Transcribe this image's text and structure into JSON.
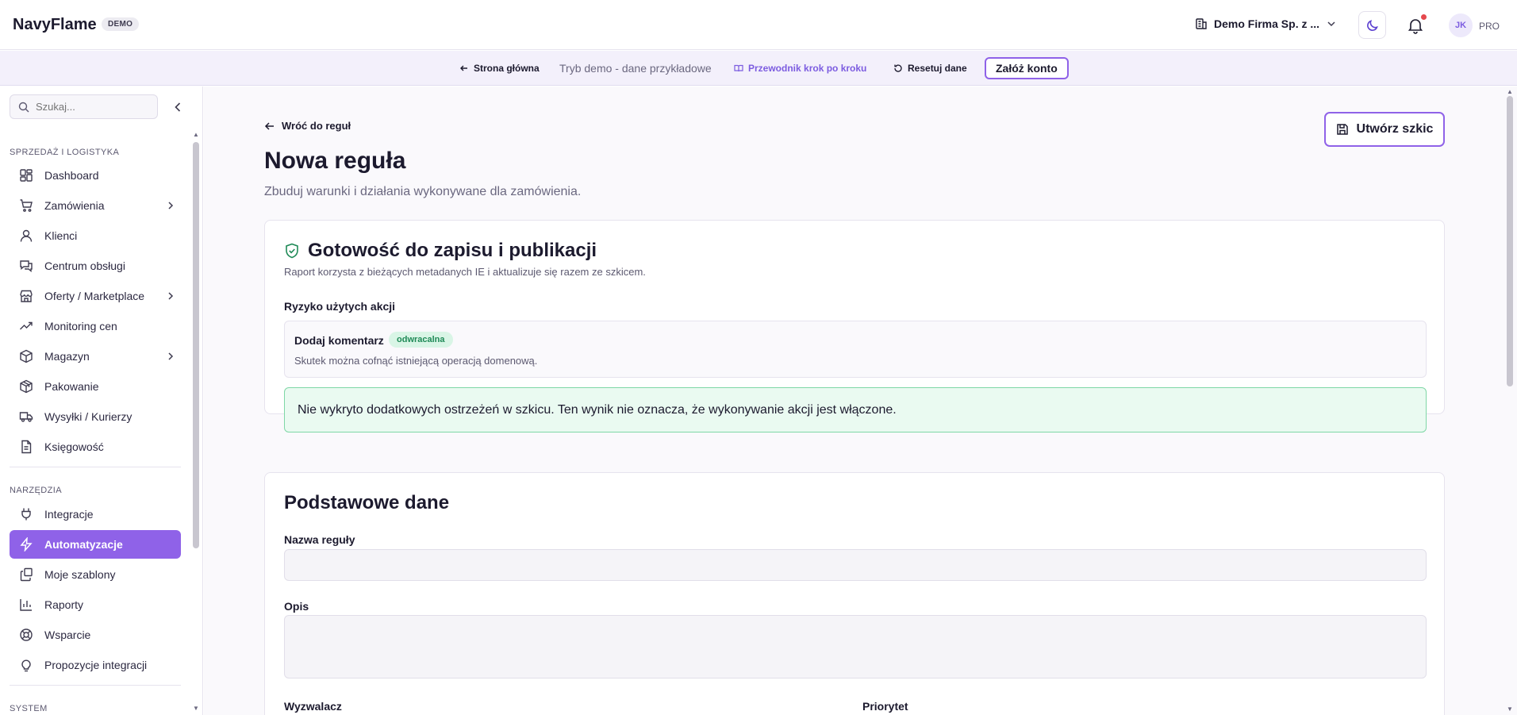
{
  "header": {
    "brand": "NavyFlame",
    "brand_badge": "DEMO",
    "company": "Demo Firma Sp. z ...",
    "avatar_initials": "JK",
    "plan": "PRO",
    "accent_color": "#8f62e8",
    "notification_color": "#e5484d"
  },
  "demo_bar": {
    "home": "Strona główna",
    "mode": "Tryb demo - dane przykładowe",
    "guide": "Przewodnik krok po kroku",
    "reset": "Resetuj dane",
    "create_account": "Załóż konto"
  },
  "sidebar": {
    "search_placeholder": "Szukaj...",
    "sections": [
      {
        "label": "SPRZEDAŻ I LOGISTYKA"
      },
      {
        "label": "NARZĘDZIA"
      },
      {
        "label": "SYSTEM"
      }
    ],
    "items": [
      {
        "label": "Dashboard",
        "icon": "dashboard-icon"
      },
      {
        "label": "Zamówienia",
        "icon": "cart-icon",
        "has_children": true
      },
      {
        "label": "Klienci",
        "icon": "user-icon"
      },
      {
        "label": "Centrum obsługi",
        "icon": "chat-icon"
      },
      {
        "label": "Oferty / Marketplace",
        "icon": "store-icon",
        "has_children": true
      },
      {
        "label": "Monitoring cen",
        "icon": "trend-icon"
      },
      {
        "label": "Magazyn",
        "icon": "box-icon",
        "has_children": true
      },
      {
        "label": "Pakowanie",
        "icon": "package-icon"
      },
      {
        "label": "Wysyłki / Kurierzy",
        "icon": "truck-icon"
      },
      {
        "label": "Księgowość",
        "icon": "document-icon"
      },
      {
        "label": "Integracje",
        "icon": "plug-icon"
      },
      {
        "label": "Automatyzacje",
        "icon": "bolt-icon",
        "active": true
      },
      {
        "label": "Moje szablony",
        "icon": "templates-icon"
      },
      {
        "label": "Raporty",
        "icon": "chart-icon"
      },
      {
        "label": "Wsparcie",
        "icon": "lifebuoy-icon"
      },
      {
        "label": "Propozycje integracji",
        "icon": "bulb-icon"
      }
    ]
  },
  "main": {
    "back_label": "Wróć do reguł",
    "draft_button": "Utwórz szkic",
    "title": "Nowa reguła",
    "subtitle": "Zbuduj warunki i działania wykonywane dla zamówienia.",
    "readiness": {
      "title": "Gotowość do zapisu i publikacji",
      "subtitle": "Raport korzysta z bieżących metadanych IE i aktualizuje się razem ze szkicem.",
      "risk_heading": "Ryzyko użytych akcji",
      "action_name": "Dodaj komentarz",
      "action_badge": "odwracalna",
      "action_desc": "Skutek można cofnąć istniejącą operacją domenową.",
      "ok_message": "Nie wykryto dodatkowych ostrzeżeń w szkicu. Ten wynik nie oznacza, że wykonywanie akcji jest włączone."
    },
    "basic": {
      "title": "Podstawowe dane",
      "name_label": "Nazwa reguły",
      "name_value": "",
      "description_label": "Opis",
      "description_value": "",
      "trigger_label": "Wyzwalacz",
      "priority_label": "Priorytet"
    }
  }
}
